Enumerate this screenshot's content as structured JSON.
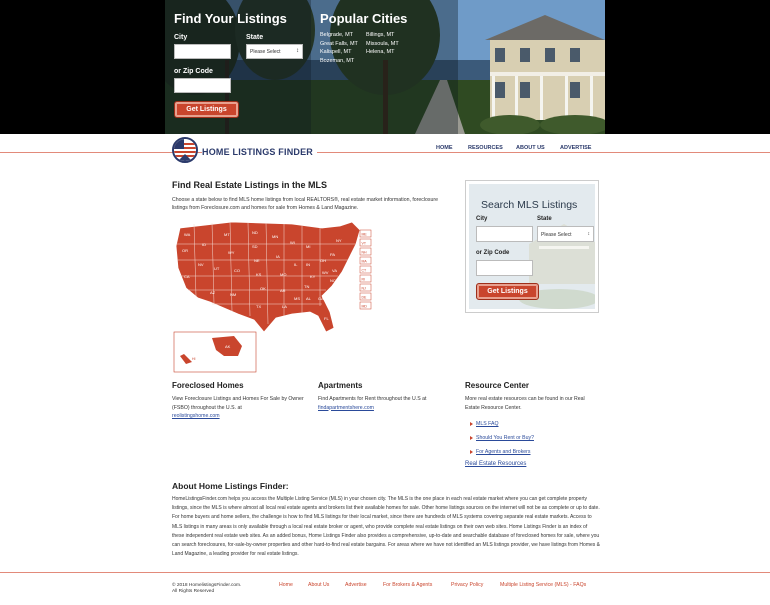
{
  "hero": {
    "find_title": "Find Your Listings",
    "city_label": "City",
    "state_label": "State",
    "state_select": "Please Select",
    "zip_label": "or Zip Code",
    "button": "Get Listings",
    "popular_title": "Popular Cities",
    "cities_col1": [
      "Belgrade, MT",
      "Great Falls, MT",
      "Kalispell, MT",
      "Bozeman, MT"
    ],
    "cities_col2": [
      "Billings, MT",
      "Missoula, MT",
      "Helena, MT"
    ]
  },
  "header": {
    "logo_text": "HOME LISTINGS FINDER",
    "nav": [
      "HOME",
      "RESOURCES",
      "ABOUT US",
      "ADVERTISE"
    ]
  },
  "main": {
    "title": "Find Real Estate Listings in the MLS",
    "desc": "Choose a state below to find MLS home listings from local REALTORS®, real estate market information, foreclosure listings from Foreclosure.com and homes for sale from Homes & Land Magazine.",
    "map_states": [
      "WA",
      "OR",
      "CA",
      "ID",
      "NV",
      "MT",
      "WY",
      "UT",
      "AZ",
      "CO",
      "NM",
      "ND",
      "SD",
      "NE",
      "KS",
      "OK",
      "TX",
      "MN",
      "IA",
      "MO",
      "AR",
      "LA",
      "WI",
      "IL",
      "MS",
      "MI",
      "IN",
      "KY",
      "TN",
      "AL",
      "OH",
      "GA",
      "FL",
      "SC",
      "NC",
      "VA",
      "WV",
      "PA",
      "NY",
      "ME",
      "VT",
      "NH",
      "MA",
      "CT",
      "RI",
      "NJ",
      "DE",
      "MD",
      "AK",
      "HI"
    ]
  },
  "search": {
    "title": "Search MLS Listings",
    "city_label": "City",
    "state_label": "State",
    "state_select": "Please Select",
    "zip_label": "or Zip Code",
    "button": "Get Listings"
  },
  "columns": {
    "foreclosed_title": "Foreclosed Homes",
    "foreclosed_text": "View Foreclosure Listings and Homes For Sale by Owner (FSBO) throughout the U.S. at",
    "foreclosed_link": "reolistingshome.com",
    "apartments_title": "Apartments",
    "apartments_text": "Find Apartments for Rent throughout the U.S at",
    "apartments_link": "findapartmentshere.com",
    "resource_title": "Resource Center",
    "resource_text": "More real estate resources can be found in our Real Estate Resource Center.",
    "resource_links": [
      "MLS FAQ",
      "Should You Rent or Buy?",
      "For Agents and Brokers"
    ],
    "resource_main_link": "Real Estate Resources"
  },
  "about": {
    "title": "About Home Listings Finder:",
    "text": "HomeListingsFinder.com helps you access the Multiple Listing Service (MLS) in your chosen city. The MLS is the one place in each real estate market where you can get complete property listings, since the MLS is where almost all local real estate agents and brokers list their available homes for sale. Other home listings sources on the internet will not be as complete or up to date. For home buyers and home sellers, the challenge is how to find MLS listings for their local market, since there are hundreds of MLS systems covering separate real estate markets. Access to MLS listings in many areas is only available through a local real estate broker or agent, who provide complete real estate listings on their own web sites. Home Listings Finder is an index of these independent real estate web sites. As an added bonus, Home Listings Finder also provides a comprehensive, up-to-date and searchable database of foreclosed homes for sale, where you can search foreclosures, for-sale-by-owner properties and other hard-to-find real estate bargains. For areas where we have not identified an MLS listings provider, we have listings from Homes & Land Magazine, a leading provider for real estate listings."
  },
  "footer": {
    "copyright": "© 2018 HomelistingsFinder.com.",
    "rights": "All Rights Reserved",
    "links": [
      "Home",
      "About Us",
      "Advertise",
      "For Brokers & Agents",
      "Privacy Policy",
      "Multiple Listing Service (MLS) - FAQs"
    ]
  },
  "colors": {
    "accent": "#c9452d",
    "navy": "#2b3a6b",
    "map": "#c9452d"
  }
}
